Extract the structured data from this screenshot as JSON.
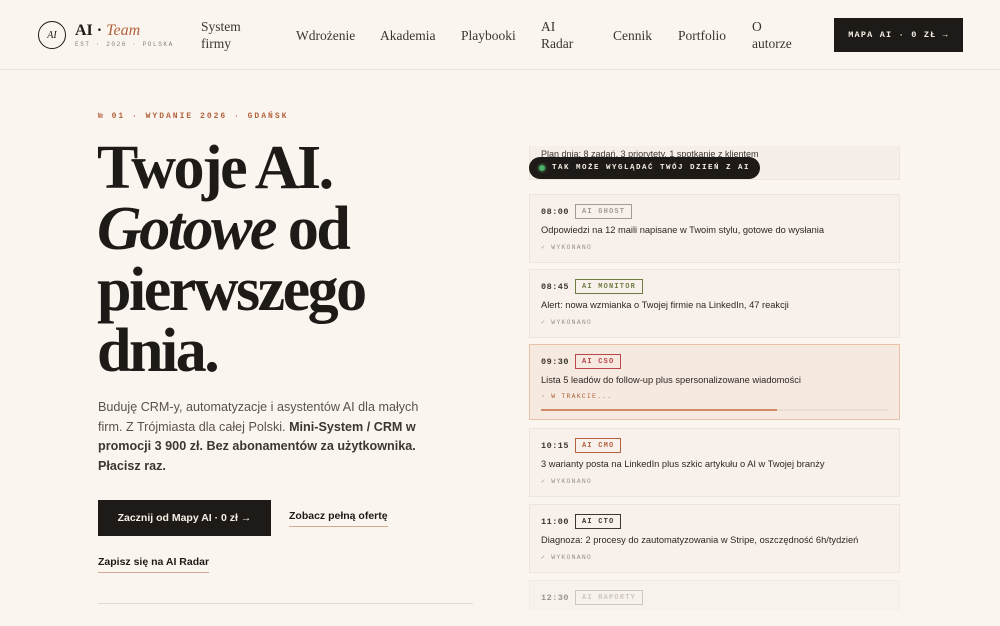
{
  "header": {
    "logo_mark": "AI",
    "logo_brand": "AI · ",
    "logo_team": "Team",
    "logo_sub": "EST · 2026 · POLSKA",
    "nav": [
      {
        "line1": "System",
        "line2": "firmy"
      },
      {
        "line1": "Wdrożenie",
        "line2": ""
      },
      {
        "line1": "Akademia",
        "line2": ""
      },
      {
        "line1": "Playbooki",
        "line2": ""
      },
      {
        "line1": "AI",
        "line2": "Radar"
      },
      {
        "line1": "Cennik",
        "line2": ""
      },
      {
        "line1": "Portfolio",
        "line2": ""
      },
      {
        "line1": "O",
        "line2": "autorze"
      }
    ],
    "cta_label": "MAPA AI · 0 ZŁ",
    "cta_arrow": "→"
  },
  "hero": {
    "eyebrow": "№ 01 · WYDANIE 2026 · GDAŃSK",
    "title_line1": "Twoje AI.",
    "title_italic": "Gotowe",
    "title_line2_rest": " od",
    "title_line3": "pierwszego",
    "title_line4": "dnia.",
    "desc_plain": "Buduję CRM-y, automatyzacje i asystentów AI dla małych firm. Z Trójmiasta dla całej Polski. ",
    "desc_bold": "Mini-System / CRM w promocji 3 900 zł. Bez abonamentów za użytkownika. Płacisz raz.",
    "cta_primary": "Zacznij od Mapy AI · 0 zł →",
    "cta_secondary": "Zobacz pełną ofertę",
    "cta_radar": "Zapisz się na AI Radar"
  },
  "timeline": {
    "plan_text": "Plan dnia: 8 zadań, 3 priorytety, 1 spotkanie z klientem",
    "pill_label": "TAK MOŻE WYGLĄDAĆ TWÓJ DZIEŃ Z AI",
    "tasks": [
      {
        "time": "08:00",
        "tag": "AI GHOST",
        "desc": "Odpowiedzi na 12 maili napisane w Twoim stylu, gotowe do wysłania",
        "status": "✓ WYKONANO"
      },
      {
        "time": "08:45",
        "tag": "AI MONITOR",
        "desc": "Alert: nowa wzmianka o Twojej firmie na LinkedIn, 47 reakcji",
        "status": "✓ WYKONANO"
      },
      {
        "time": "09:30",
        "tag": "AI CSO",
        "desc": "Lista 5 leadów do follow-up plus spersonalizowane wiadomości",
        "status": "◦ W TRAKCIE...",
        "progress": 0.68
      },
      {
        "time": "10:15",
        "tag": "AI CMO",
        "desc": "3 warianty posta na LinkedIn plus szkic artykułu o AI w Twojej branży",
        "status": "✓ WYKONANO"
      },
      {
        "time": "11:00",
        "tag": "AI CTO",
        "desc": "Diagnoza: 2 procesy do zautomatyzowania w Stripe, oszczędność 6h/tydzień",
        "status": "✓ WYKONANO"
      },
      {
        "time": "12:30",
        "tag": "AI RAPORTY"
      }
    ],
    "tag_colors": {
      "ghost": "#a39a91",
      "monitor": "#6f7d45",
      "cso": "#b8474b",
      "cmo": "#b3623d",
      "cto": "#3d3731",
      "raporty": "#a39a91"
    }
  }
}
